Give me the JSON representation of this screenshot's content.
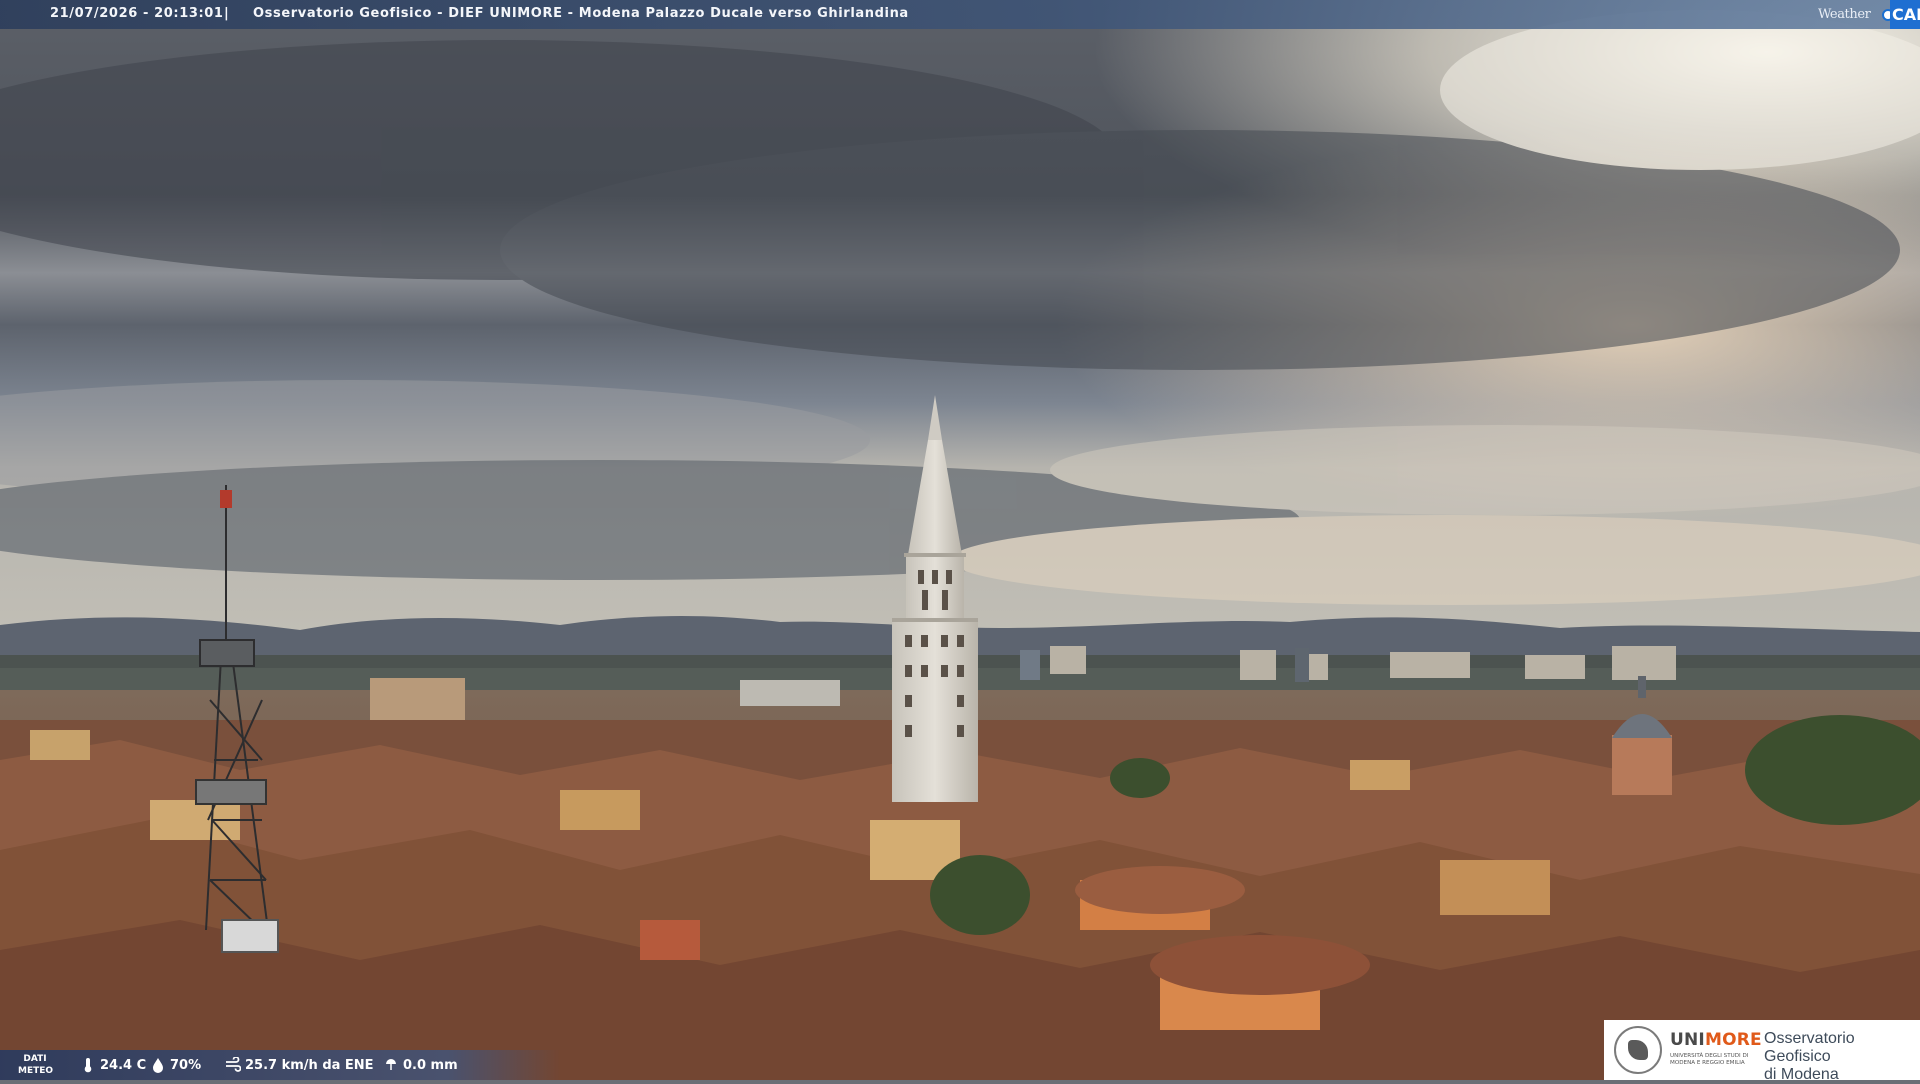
{
  "header": {
    "timestamp": "21/07/2026 - 20:13:01",
    "separator": "|",
    "caption": "Osservatorio Geofisico - DIEF UNIMORE - Modena Palazzo Ducale verso Ghirlandina",
    "brand_word": "Weather",
    "brand_cam": "CAM"
  },
  "weather": {
    "label_line1": "DATI",
    "label_line2": "METEO",
    "temperature": "24.4 C",
    "humidity": "70%",
    "wind": "25.7 km/h da ENE",
    "rain": "0.0 mm"
  },
  "logo": {
    "uni": "UNI",
    "more": "MORE",
    "subtitle": "UNIVERSITÀ DEGLI STUDI DI MODENA E REGGIO EMILIA",
    "line1": "Osservatorio Geofisico",
    "line2": "di Modena"
  },
  "icons": {
    "temperature": "thermometer-icon",
    "humidity": "droplet-icon",
    "wind": "wind-icon",
    "rain": "rain-icon",
    "brand_dot": "dot-icon"
  },
  "colors": {
    "banner": "#2d3e5c",
    "brand_blue": "#1f6fd1",
    "unimore_orange": "#e05a1a",
    "sky_dark": "#4e535b",
    "sky_light": "#e9e4da",
    "roofs": "#8a5a44",
    "tower": "#d8d4cc"
  }
}
